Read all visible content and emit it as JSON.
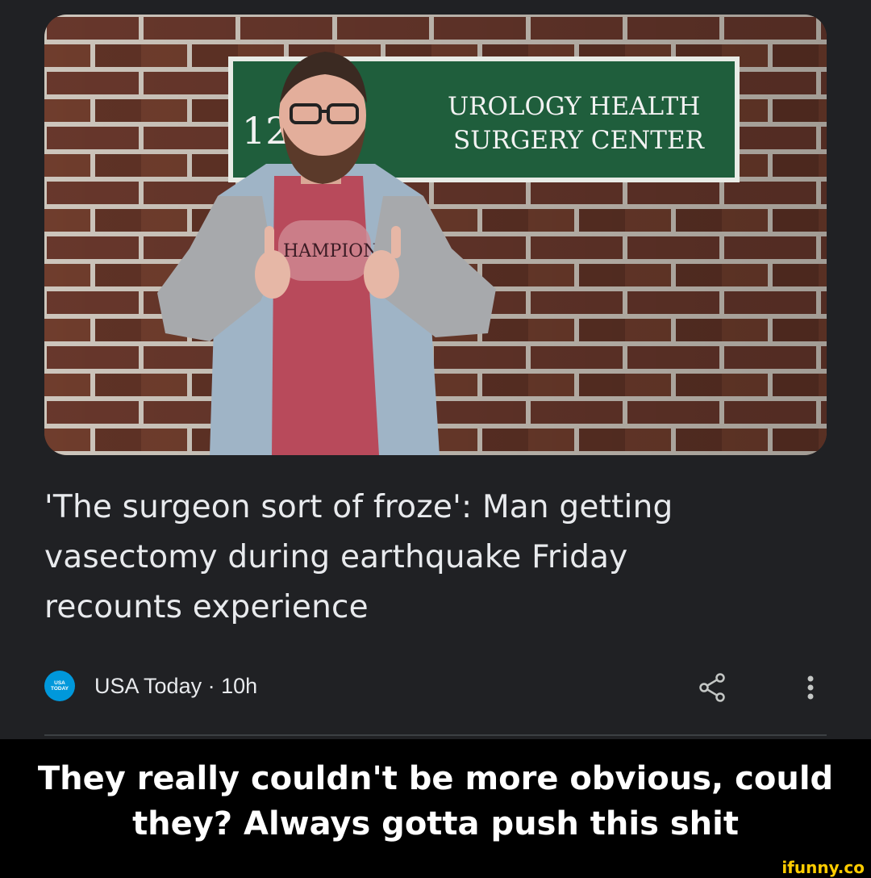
{
  "article": {
    "photo": {
      "sign_number": "12",
      "sign_line1": "UROLOGY HEALTH",
      "sign_line2": "SURGERY CENTER",
      "shirt_text": "HAMPIONS"
    },
    "headline_lines": [
      "'The surgeon sort of froze': Man getting",
      "vasectomy during earthquake Friday",
      "recounts experience"
    ],
    "source": {
      "logo_line1": "USA",
      "logo_line2": "TODAY",
      "label": "USA Today · 10h"
    },
    "actions": {
      "share_icon": "share-icon",
      "more_icon": "more-vert-icon"
    }
  },
  "caption": {
    "line1": "They really couldn't be more obvious, could",
    "line2": "they? Always gotta push this shit"
  },
  "watermark": "ifunny.co",
  "colors": {
    "card_background": "#202124",
    "text_primary": "#e8eaed",
    "sign_green": "#1f5e3c",
    "brick": "#6e3b2e",
    "source_logo": "#0098db",
    "watermark": "#ffcc00"
  }
}
